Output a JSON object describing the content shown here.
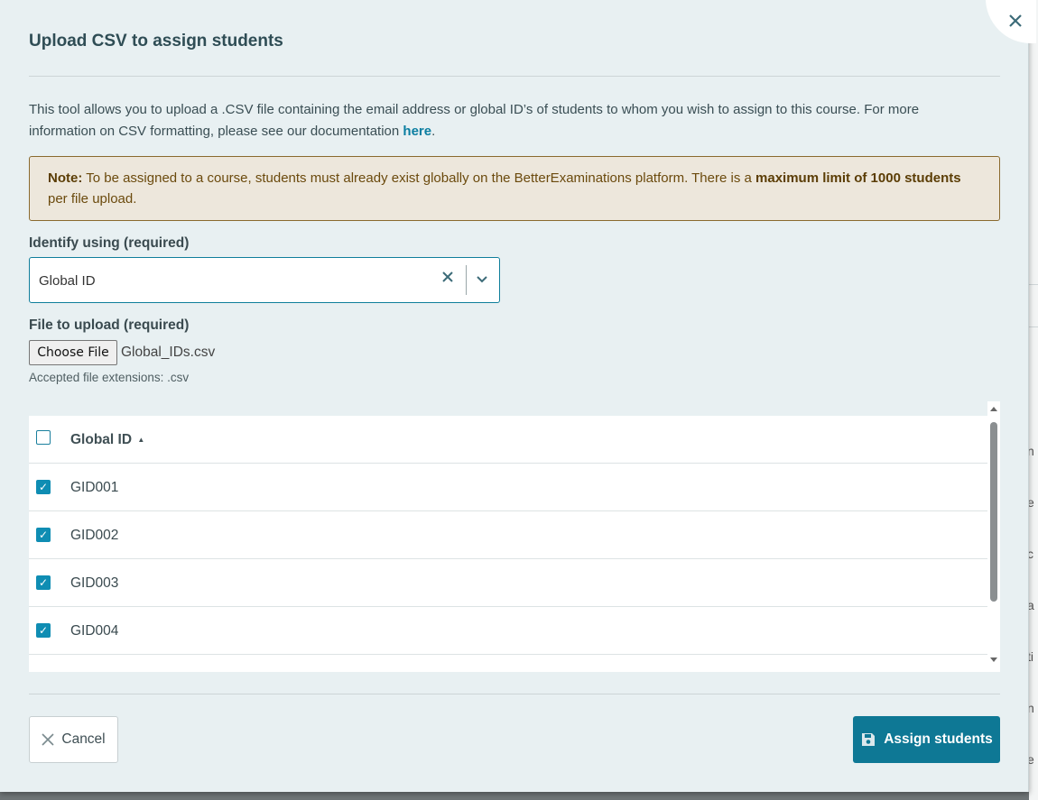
{
  "modal": {
    "title": "Upload CSV to assign students",
    "description_text": "This tool allows you to upload a .CSV file containing the email address or global ID’s of students to whom you wish to assign to this course. For more information on CSV formatting, please see our documentation ",
    "description_link": "here",
    "description_end": "."
  },
  "note": {
    "label": "Note:",
    "text1": " To be assigned to a course, students must already exist globally on the BetterExaminations platform. There is a ",
    "bold": "maximum limit of 1000 students",
    "text2": " per file upload."
  },
  "identify": {
    "label": "Identify using (required)",
    "value": "Global ID"
  },
  "file": {
    "label": "File to upload (required)",
    "button": "Choose File",
    "name": "Global_IDs.csv",
    "help": "Accepted file extensions: .csv"
  },
  "table": {
    "header": "Global ID",
    "sort_indicator": "▲",
    "rows": [
      {
        "id": "GID001",
        "checked": true
      },
      {
        "id": "GID002",
        "checked": true
      },
      {
        "id": "GID003",
        "checked": true
      },
      {
        "id": "GID004",
        "checked": true
      }
    ]
  },
  "footer": {
    "cancel": "Cancel",
    "assign": "Assign students"
  },
  "background_fragments": [
    "n",
    "e",
    "c",
    "a",
    "ti",
    "n",
    "e"
  ],
  "colors": {
    "accent": "#0e7895",
    "modal_bg": "#e8f0f2",
    "note_border": "#8a6a2f"
  }
}
